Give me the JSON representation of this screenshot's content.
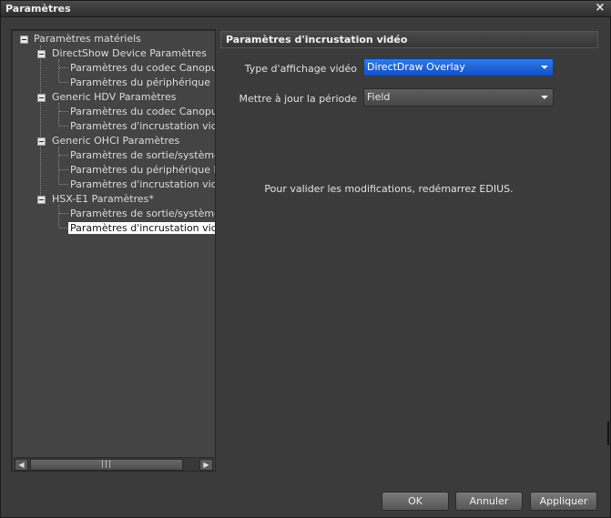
{
  "window": {
    "title": "Paramètres",
    "close_glyph": "×"
  },
  "tree": {
    "root": "Paramètres matériels",
    "groups": [
      {
        "label": "DirectShow Device Paramètres",
        "children": [
          "Paramètres du codec Canopus HQ",
          "Paramètres du périphérique"
        ]
      },
      {
        "label": "Generic HDV Paramètres",
        "children": [
          "Paramètres du codec Canopus HQ",
          "Paramètres d'incrustation vidéo"
        ]
      },
      {
        "label": "Generic OHCI Paramètres",
        "children": [
          "Paramètres de sortie/système",
          "Paramètres du périphérique DV",
          "Paramètres d'incrustation vidéo"
        ]
      },
      {
        "label": "HSX-E1 Paramètres*",
        "children": [
          "Paramètres de sortie/système",
          "Paramètres d'incrustation vidéo"
        ]
      }
    ],
    "selected": "Paramètres d'incrustation vidéo",
    "scrollbar": {
      "left_arrow": "◀",
      "thumb_grip": "|||",
      "right_arrow": "▶"
    }
  },
  "panel": {
    "header": "Paramètres d'incrustation vidéo",
    "fields": [
      {
        "label": "Type d'affichage vidéo",
        "value": "DirectDraw Overlay"
      },
      {
        "label": "Mettre à jour la période",
        "value": "Field"
      }
    ],
    "notice": "Pour valider les modifications, redémarrez EDIUS."
  },
  "buttons": {
    "ok": "OK",
    "cancel": "Annuler",
    "apply": "Appliquer"
  },
  "colors": {
    "accent": "#1f66d8",
    "background": "#3b3b3b",
    "panel": "#444444",
    "selected_bg": "#ffffff"
  }
}
